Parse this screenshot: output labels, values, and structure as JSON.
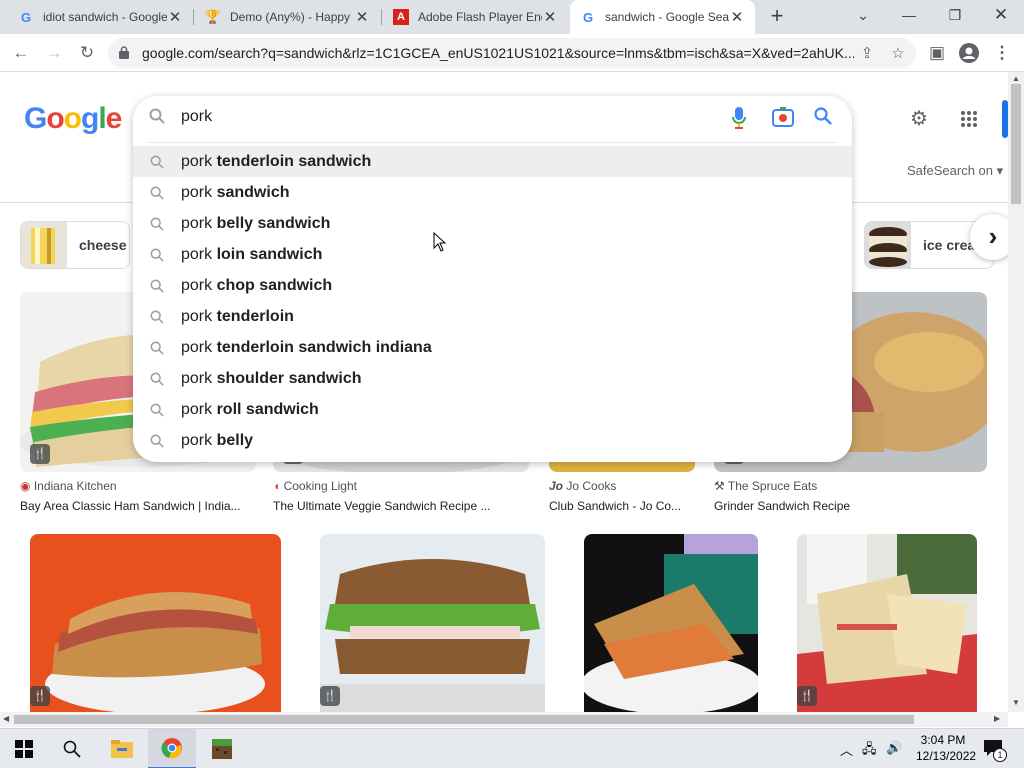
{
  "tabs": [
    {
      "title": "idiot sandwich - Google",
      "favicon": "google-icon"
    },
    {
      "title": "Demo (Any%) - Happy",
      "favicon": "trophy-icon"
    },
    {
      "title": "Adobe Flash Player End",
      "favicon": "adobe-icon"
    },
    {
      "title": "sandwich - Google Sea",
      "favicon": "google-icon"
    }
  ],
  "address": {
    "url": "google.com/search?q=sandwich&rlz=1C1GCEA_enUS1021US1021&source=lnms&tbm=isch&sa=X&ved=2ahUK..."
  },
  "search": {
    "query": "pork",
    "suggestions": [
      {
        "prefix": "pork",
        "bold": "tenderloin sandwich"
      },
      {
        "prefix": "pork",
        "bold": "sandwich"
      },
      {
        "prefix": "pork",
        "bold": "belly sandwich"
      },
      {
        "prefix": "pork",
        "bold": "loin sandwich"
      },
      {
        "prefix": "pork",
        "bold": "chop sandwich"
      },
      {
        "prefix": "pork",
        "bold": "tenderloin"
      },
      {
        "prefix": "pork",
        "bold": "tenderloin sandwich indiana"
      },
      {
        "prefix": "pork",
        "bold": "shoulder sandwich"
      },
      {
        "prefix": "pork",
        "bold": "roll sandwich"
      },
      {
        "prefix": "pork",
        "bold": "belly"
      }
    ]
  },
  "header": {
    "safesearch": "SafeSearch on"
  },
  "chips": [
    {
      "label": "cheese"
    },
    {
      "label": "ice crea"
    }
  ],
  "results": [
    {
      "source": "Indiana Kitchen",
      "caption": "Bay Area Classic Ham Sandwich | India..."
    },
    {
      "source": "Cooking Light",
      "caption": "The Ultimate Veggie Sandwich Recipe ..."
    },
    {
      "source": "Jo Cooks",
      "caption": "Club Sandwich - Jo Co..."
    },
    {
      "source": "The Spruce Eats",
      "caption": "Grinder Sandwich Recipe"
    }
  ],
  "taskbar": {
    "time": "3:04 PM",
    "date": "12/13/2022",
    "notif_count": "1"
  },
  "colors": {
    "google_blue": "#4285f4",
    "google_red": "#ea4335",
    "google_yellow": "#fbbc05",
    "google_green": "#34a853",
    "accent": "#1a73e8"
  }
}
